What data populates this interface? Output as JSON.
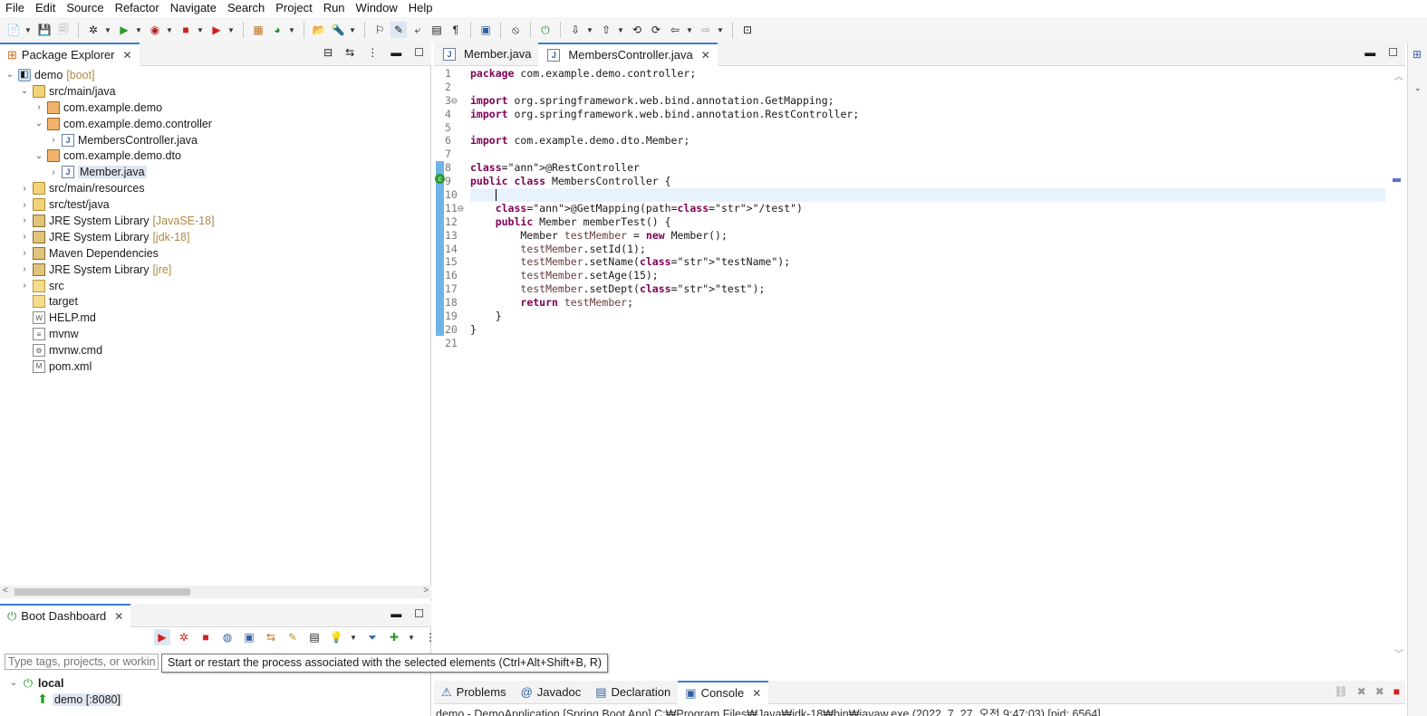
{
  "menu": [
    "File",
    "Edit",
    "Source",
    "Refactor",
    "Navigate",
    "Search",
    "Project",
    "Run",
    "Window",
    "Help"
  ],
  "package_explorer": {
    "title": "Package Explorer",
    "tree": [
      {
        "label": "demo",
        "deco": "[boot]",
        "indent": 0,
        "twisty": "down",
        "icon": "project-icon"
      },
      {
        "label": "src/main/java",
        "deco": "",
        "indent": 1,
        "twisty": "down",
        "icon": "source-folder-icon"
      },
      {
        "label": "com.example.demo",
        "deco": "",
        "indent": 2,
        "twisty": "right",
        "icon": "package-icon"
      },
      {
        "label": "com.example.demo.controller",
        "deco": "",
        "indent": 2,
        "twisty": "down",
        "icon": "package-icon"
      },
      {
        "label": "MembersController.java",
        "deco": "",
        "indent": 3,
        "twisty": "right",
        "icon": "java-file-icon"
      },
      {
        "label": "com.example.demo.dto",
        "deco": "",
        "indent": 2,
        "twisty": "down",
        "icon": "package-icon"
      },
      {
        "label": "Member.java",
        "deco": "",
        "indent": 3,
        "twisty": "right",
        "icon": "java-file-icon",
        "selected": true
      },
      {
        "label": "src/main/resources",
        "deco": "",
        "indent": 1,
        "twisty": "right",
        "icon": "source-folder-icon"
      },
      {
        "label": "src/test/java",
        "deco": "",
        "indent": 1,
        "twisty": "right",
        "icon": "source-folder-icon"
      },
      {
        "label": "JRE System Library",
        "deco": "[JavaSE-18]",
        "indent": 1,
        "twisty": "right",
        "icon": "library-icon"
      },
      {
        "label": "JRE System Library",
        "deco": "[jdk-18]",
        "indent": 1,
        "twisty": "right",
        "icon": "library-icon"
      },
      {
        "label": "Maven Dependencies",
        "deco": "",
        "indent": 1,
        "twisty": "right",
        "icon": "library-icon"
      },
      {
        "label": "JRE System Library",
        "deco": "[jre]",
        "indent": 1,
        "twisty": "right",
        "icon": "library-icon"
      },
      {
        "label": "src",
        "deco": "",
        "indent": 1,
        "twisty": "right",
        "icon": "folder-icon"
      },
      {
        "label": "target",
        "deco": "",
        "indent": 1,
        "twisty": "none",
        "icon": "folder-icon"
      },
      {
        "label": "HELP.md",
        "deco": "",
        "indent": 1,
        "twisty": "none",
        "icon": "markdown-file-icon"
      },
      {
        "label": "mvnw",
        "deco": "",
        "indent": 1,
        "twisty": "none",
        "icon": "text-file-icon"
      },
      {
        "label": "mvnw.cmd",
        "deco": "",
        "indent": 1,
        "twisty": "none",
        "icon": "cmd-file-icon"
      },
      {
        "label": "pom.xml",
        "deco": "",
        "indent": 1,
        "twisty": "none",
        "icon": "maven-file-icon"
      }
    ]
  },
  "boot_dashboard": {
    "title": "Boot Dashboard",
    "filter_placeholder": "Type tags, projects, or working set names to match (incl. * and ? wildcards)",
    "tooltip": "Start or restart the process associated with the selected elements (Ctrl+Alt+Shift+B, R)",
    "local_label": "local",
    "app_label": "demo [:8080]"
  },
  "editor": {
    "tabs": [
      {
        "label": "Member.java",
        "active": false
      },
      {
        "label": "MembersController.java",
        "active": true
      }
    ],
    "code": [
      "package com.example.demo.controller;",
      "",
      "import org.springframework.web.bind.annotation.GetMapping;",
      "import org.springframework.web.bind.annotation.RestController;",
      "",
      "import com.example.demo.dto.Member;",
      "",
      "@RestController",
      "public class MembersController {",
      "    ",
      "    @GetMapping(path=\"/test\")",
      "    public Member memberTest() {",
      "        Member testMember = new Member();",
      "        testMember.setId(1);",
      "        testMember.setName(\"testName\");",
      "        testMember.setAge(15);",
      "        testMember.setDept(\"test\");",
      "        return testMember;",
      "    }",
      "}",
      ""
    ]
  },
  "bottom_tabs": [
    {
      "label": "Problems",
      "icon": "problems-icon"
    },
    {
      "label": "Javadoc",
      "icon": "javadoc-icon"
    },
    {
      "label": "Declaration",
      "icon": "declaration-icon"
    },
    {
      "label": "Console",
      "icon": "console-icon",
      "active": true
    }
  ],
  "console": {
    "line": "demo - DemoApplication [Spring Boot App] C:₩Program Files₩Java₩jdk-18₩bin₩javaw.exe  (2022. 7. 27. 오전 9:47:03) [pid: 6564]"
  },
  "colors": {
    "keyword": "#7f0055",
    "annotation": "#646464",
    "string": "#2a00ff",
    "field": "#6a3e3e",
    "active_tab_accent": "#3a7dd8",
    "change_ruler": "#6fb4e6"
  }
}
